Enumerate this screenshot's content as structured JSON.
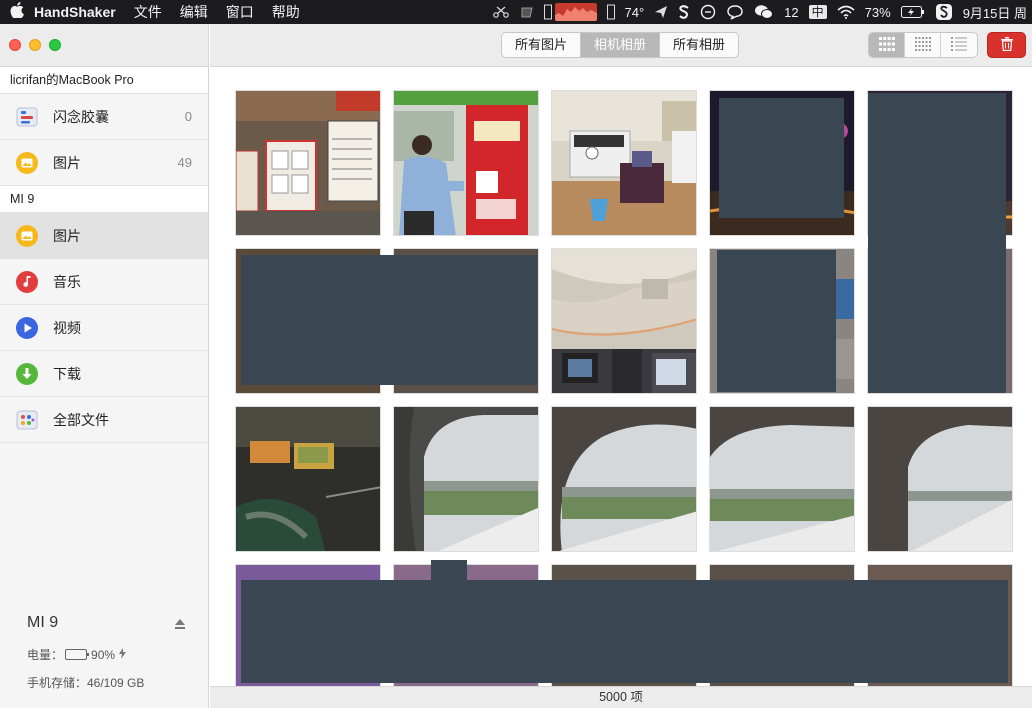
{
  "menubar": {
    "app_name": "HandShaker",
    "menus": [
      "文件",
      "编辑",
      "窗口",
      "帮助"
    ],
    "temperature": "74°",
    "wechat_count": "12",
    "ime": "中",
    "battery": "73%",
    "date": "9月15日 周"
  },
  "sidebar": {
    "mac_header": "licrifan的MacBook Pro",
    "mac_items": [
      {
        "label": "闪念胶囊",
        "count": "0",
        "icon": "capsule-icon"
      },
      {
        "label": "图片",
        "count": "49",
        "icon": "photos-icon"
      }
    ],
    "phone_header": "MI 9",
    "phone_items": [
      {
        "label": "图片",
        "icon": "photos-icon"
      },
      {
        "label": "音乐",
        "icon": "music-icon"
      },
      {
        "label": "视频",
        "icon": "video-icon"
      },
      {
        "label": "下载",
        "icon": "download-icon"
      },
      {
        "label": "全部文件",
        "icon": "all-files-icon"
      }
    ],
    "device": {
      "name": "MI 9",
      "battery_label": "电量：",
      "battery_value": "90%",
      "battery_level": 0.9,
      "storage": "手机存储：46/109 GB"
    }
  },
  "toolbar": {
    "tabs": [
      "所有图片",
      "相机相册",
      "所有相册"
    ],
    "active_tab": "相机相册",
    "view_modes": [
      "grid-large-icon",
      "grid-small-icon",
      "list-icon"
    ]
  },
  "status": {
    "item_count": "5000 项"
  },
  "colors": {
    "accent_red": "#d9322d",
    "redaction": "#3a4752",
    "active_tab": "#b8b8b8"
  }
}
